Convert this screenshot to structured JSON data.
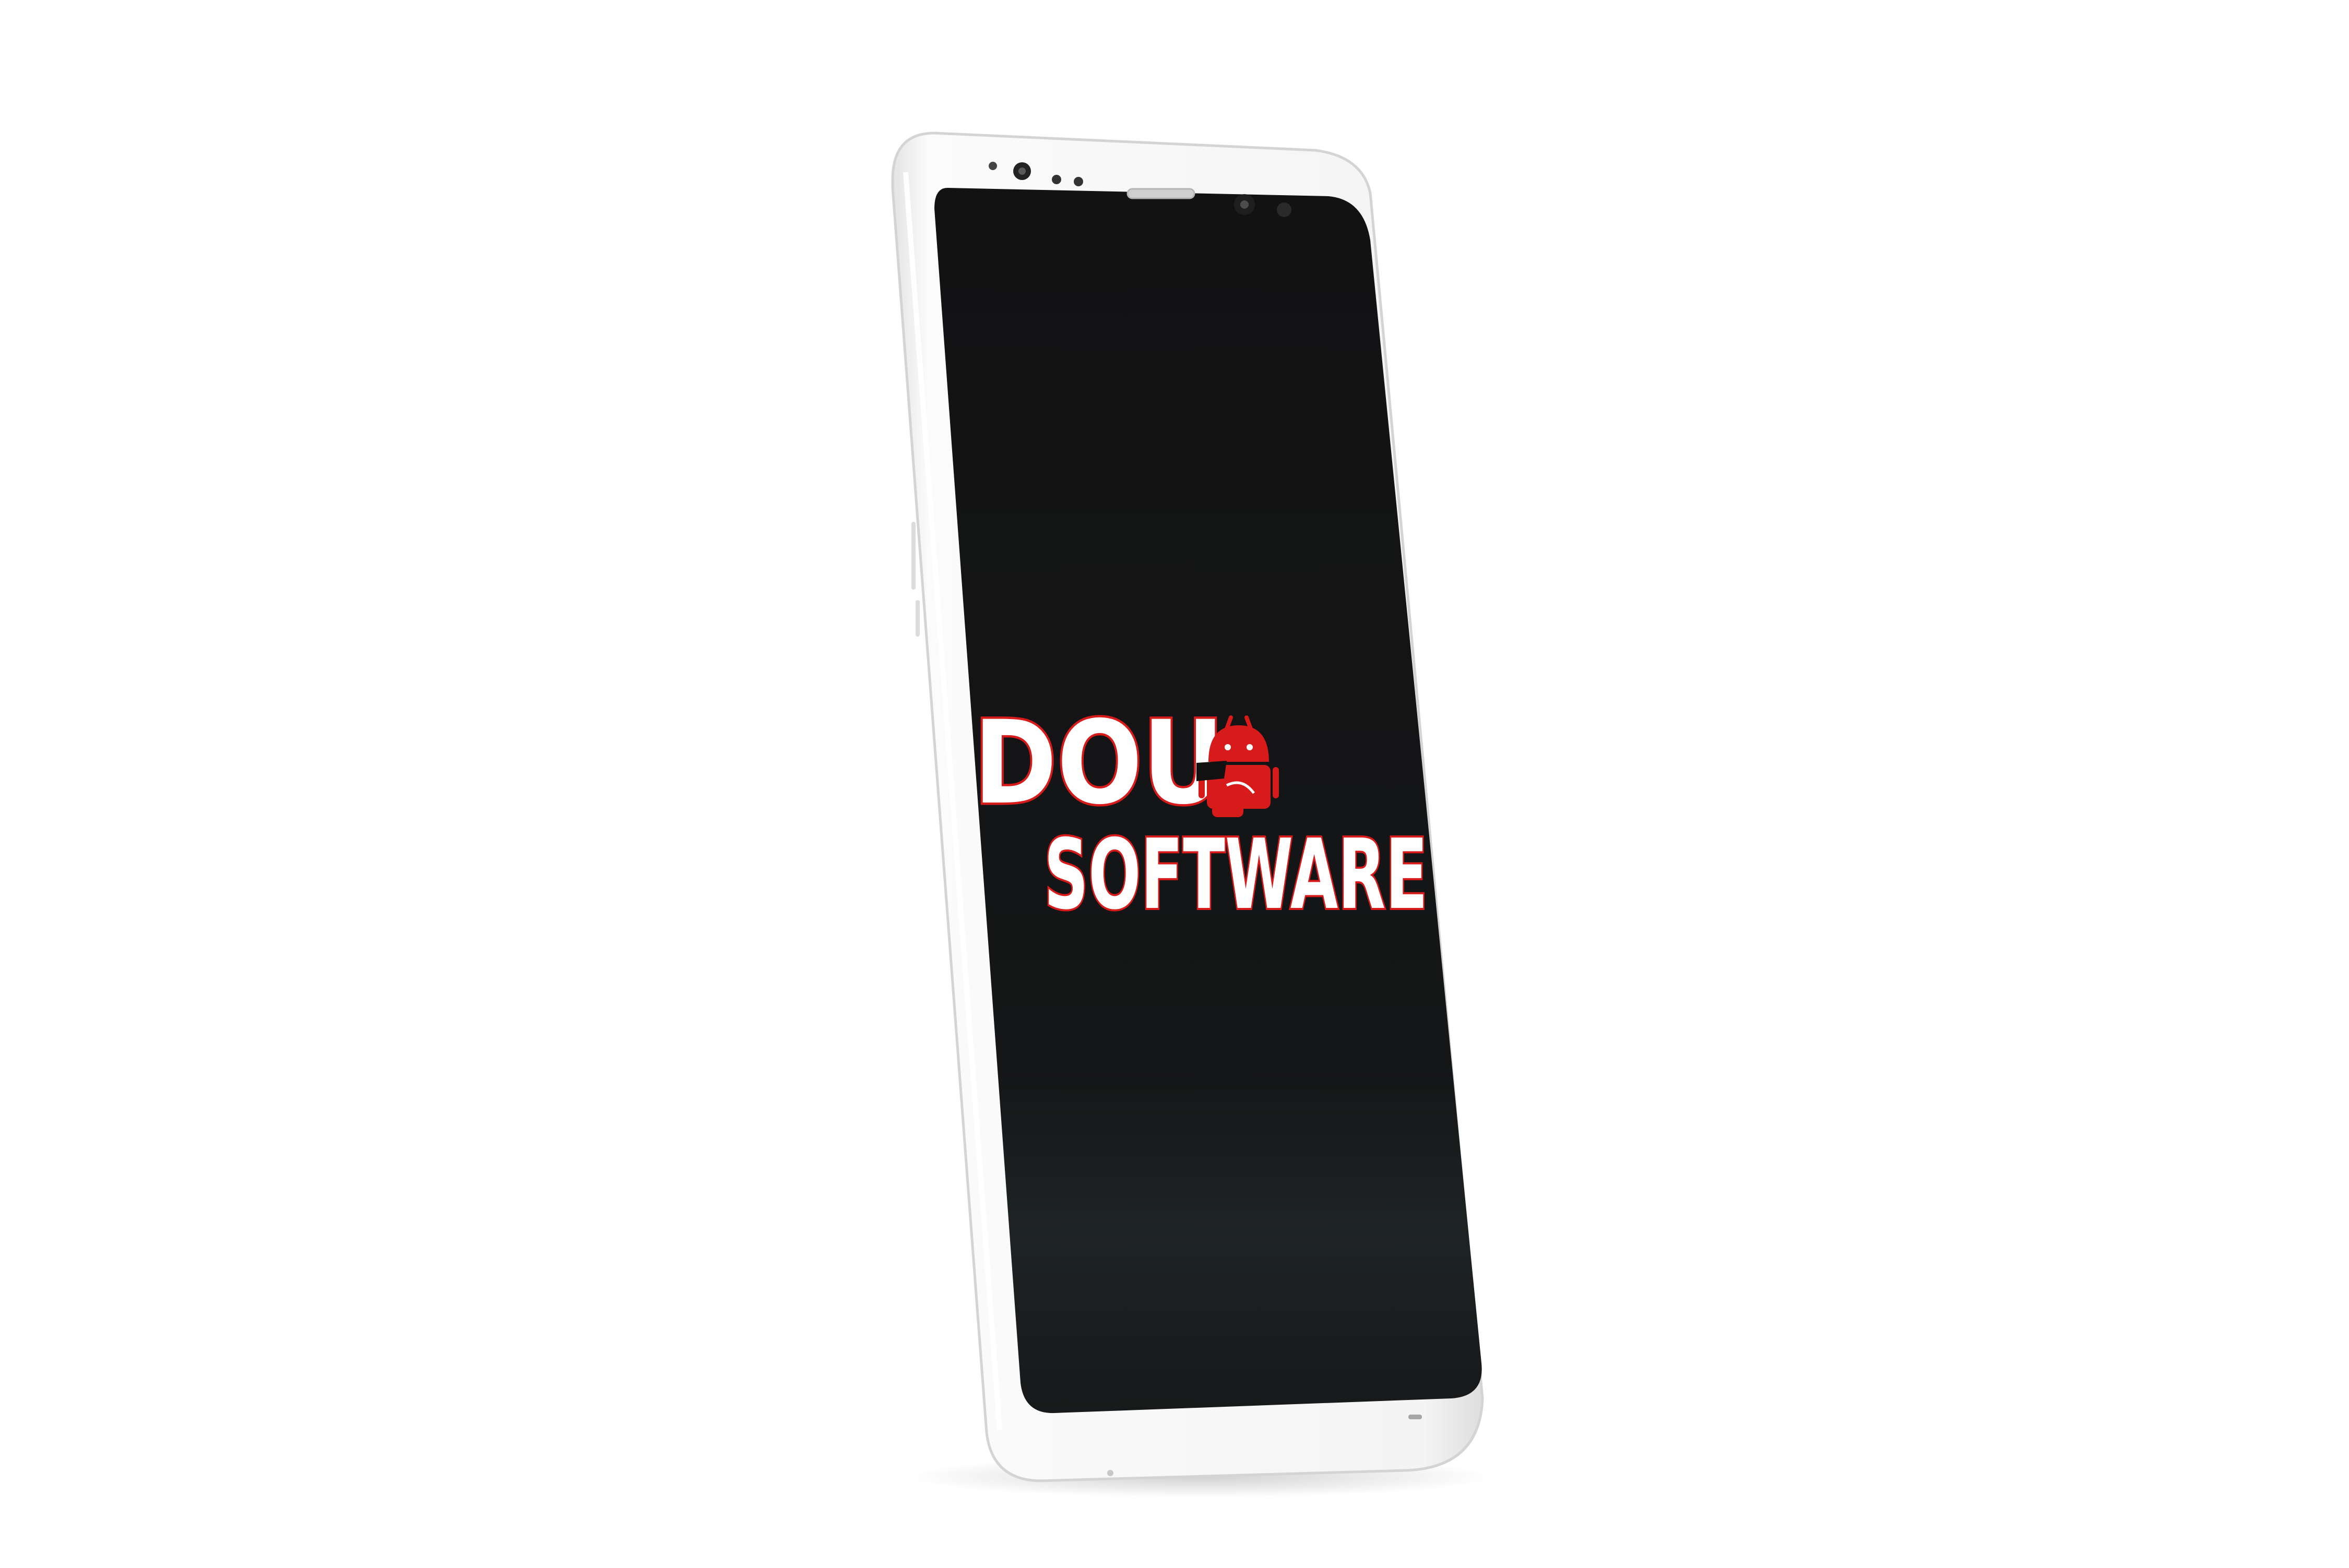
{
  "device": {
    "type": "smartphone",
    "frame_color": "#f3f3f3",
    "screen_color": "#141516"
  },
  "splash": {
    "logo_line1": "DOU",
    "logo_line2": "SOFTWARE",
    "text_fill": "#ffffff",
    "text_outline": "#d71a1a",
    "mascot": "android-robot-mascot-icon",
    "mascot_color": "#d71a1a"
  },
  "colors": {
    "background": "#ffffff",
    "brand_red": "#d71a1a"
  }
}
